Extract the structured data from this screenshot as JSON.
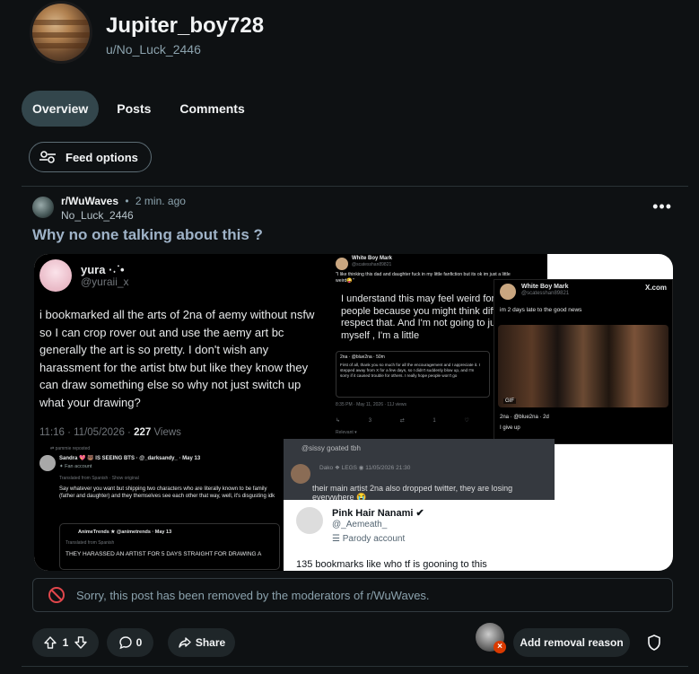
{
  "profile": {
    "display_name": "Jupiter_boy728",
    "username": "u/No_Luck_2446"
  },
  "tabs": [
    {
      "label": "Overview",
      "active": true
    },
    {
      "label": "Posts",
      "active": false
    },
    {
      "label": "Comments",
      "active": false
    }
  ],
  "feed_options_label": "Feed options",
  "post": {
    "subreddit": "r/WuWaves",
    "time": "2 min. ago",
    "author": "No_Luck_2446",
    "title": "Why no one talking about this ?",
    "removed_notice": "Sorry, this post has been removed by the moderators of r/WuWaves.",
    "votes": "1",
    "comments": "0",
    "share_label": "Share",
    "add_removal_reason_label": "Add removal reason"
  },
  "media": {
    "tweet1": {
      "name": "yura ·˖˙•",
      "handle": "@yuraii_x",
      "body": "i bookmarked all the arts of 2na of aemy without nsfw so I can crop rover out and use the aemy art bc generally the art is so pretty.  I don't wish any harassment for the artist btw but like they know they can draw something else so why not just switch up what your drawing?",
      "time": "11:16 · 11/05/2026 · ",
      "views_count": "227",
      "views_label": " Views"
    },
    "tweet2": {
      "name": "White Boy Mark",
      "handle": "@scatesshan89821",
      "quote": "\"I like thinking this dad and daughter fuck in my little fanfiction but its ok im just a little weird😜\"",
      "big": "I understand this may feel weird for some people because you might think differently, I respect that. And I'm not going to justify myself , I'm a little",
      "reply_head": "2na · @blue2na · 50m",
      "reply_body": "First of all, thank you so much for all the encouragement and I appreciate it. I stepped away from X for a few days, so I didn't suddenly blow up, and I'm sorry if it caused trouble for others. I really hope people won't go",
      "timestamp": "8:35 PM · May 11, 2026 · 11J views",
      "actions": "↳ 3 ⇄ 1 ♡ 2",
      "relevant": "Relevant ▾"
    },
    "tweet3": {
      "name": "White Boy Mark",
      "handle": "@scatesshan89821",
      "source": "X.com",
      "text": "im 2 days late to the good news",
      "gif_badge": "GIF",
      "reply_head": "2na · @blue2na · 2d",
      "reply_body": "I give up"
    },
    "tweet4": {
      "reposted": "⇄ pammie reposted",
      "name": "Sandra 💖 🐻 IS SEEING BTS · @_darksandy_ · May 13",
      "fan": "✦ Fan account",
      "translated": "Translated from Spanish · Show original",
      "body": "Say whatever you want but shipping two characters who are literally known to be family (father and daughter) and they themselves see each other that way, well, it's disgusting idk",
      "quote_name": "AnimeTrends ★ @animetrends · May 13",
      "quote_translated": "Translated from Spanish",
      "quote_body": "THEY HARASSED AN ARTIST FOR 5 DAYS STRAIGHT FOR DRAWING A"
    },
    "tweet5": {
      "reply_to": "@sissy goated tbh",
      "meta": "Dako ❖ LEGS ◉ 11/05/2026 21:30",
      "text": "their main artist 2na also dropped twitter, they are losing everywhere 😭"
    },
    "tweet6": {
      "name": "Pink Hair Nanami ✔",
      "handle": "@_Aemeath_",
      "parody": "☰ Parody account",
      "body": "135 bookmarks like who tf is gooning to this"
    }
  },
  "colors": {
    "background": "#0e1113",
    "active_tab": "#33464c",
    "title": "#9fb3c8",
    "removed_icon": "#e0464b"
  },
  "icons": [
    "feed-options-icon",
    "more-icon",
    "blocked-icon",
    "upvote-icon",
    "downvote-icon",
    "comment-icon",
    "share-icon",
    "shield-icon"
  ]
}
